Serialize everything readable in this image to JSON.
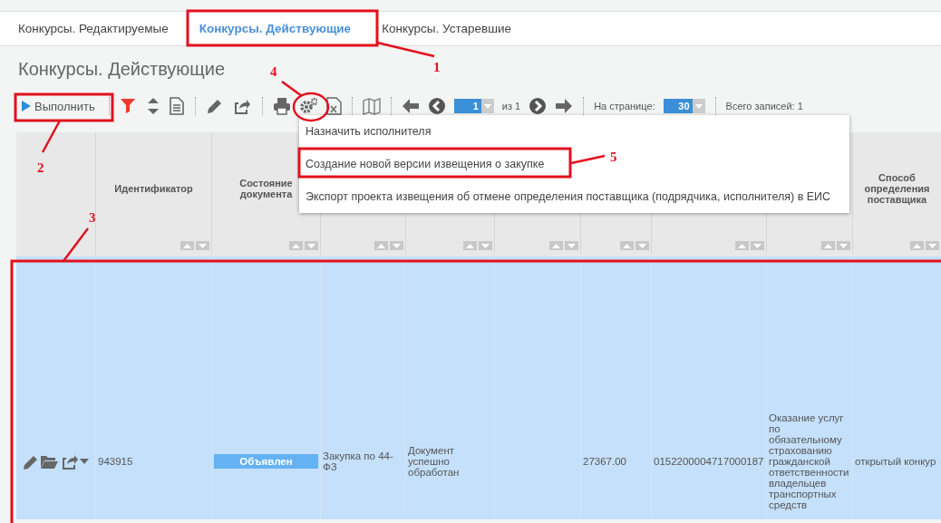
{
  "tabs": [
    {
      "label": "Конкурсы. Редактируемые",
      "selected": false
    },
    {
      "label": "Конкурсы. Действующие",
      "selected": true
    },
    {
      "label": "Конкурсы. Устаревшие",
      "selected": false
    }
  ],
  "page_title": "Конкурсы. Действующие",
  "toolbar": {
    "run_button": "Выполнить",
    "page": "1",
    "page_of": "из 1",
    "per_page_label": "На странице:",
    "per_page": "30",
    "total": "Всего записей: 1"
  },
  "menu": {
    "items": [
      {
        "label": "Назначить исполнителя"
      },
      {
        "label": "Создание новой версии извещения о закупке"
      },
      {
        "label": "Экспорт проекта извещения об отмене определения поставщика (подрядчика, исполнителя) в ЕИС"
      }
    ]
  },
  "table": {
    "columns": {
      "identifier": "Идентификатор",
      "status": "Состояние документа",
      "method": "Способ определения поставщика"
    },
    "rows": [
      {
        "selected": true,
        "identifier": "943915",
        "status": "Объявлен",
        "type": "Закупка по 44-ФЗ",
        "message": "Документ успешно обработан",
        "amount": "27367.00",
        "number": "0152200004717000187",
        "subject": "Оказание услуг по обязательному страхованию гражданской ответственности владельцев транспортных средств",
        "method": "открытый конкур"
      }
    ]
  },
  "annotations": [
    {
      "number": "1"
    },
    {
      "number": "2"
    },
    {
      "number": "3"
    },
    {
      "number": "4"
    },
    {
      "number": "5"
    }
  ]
}
